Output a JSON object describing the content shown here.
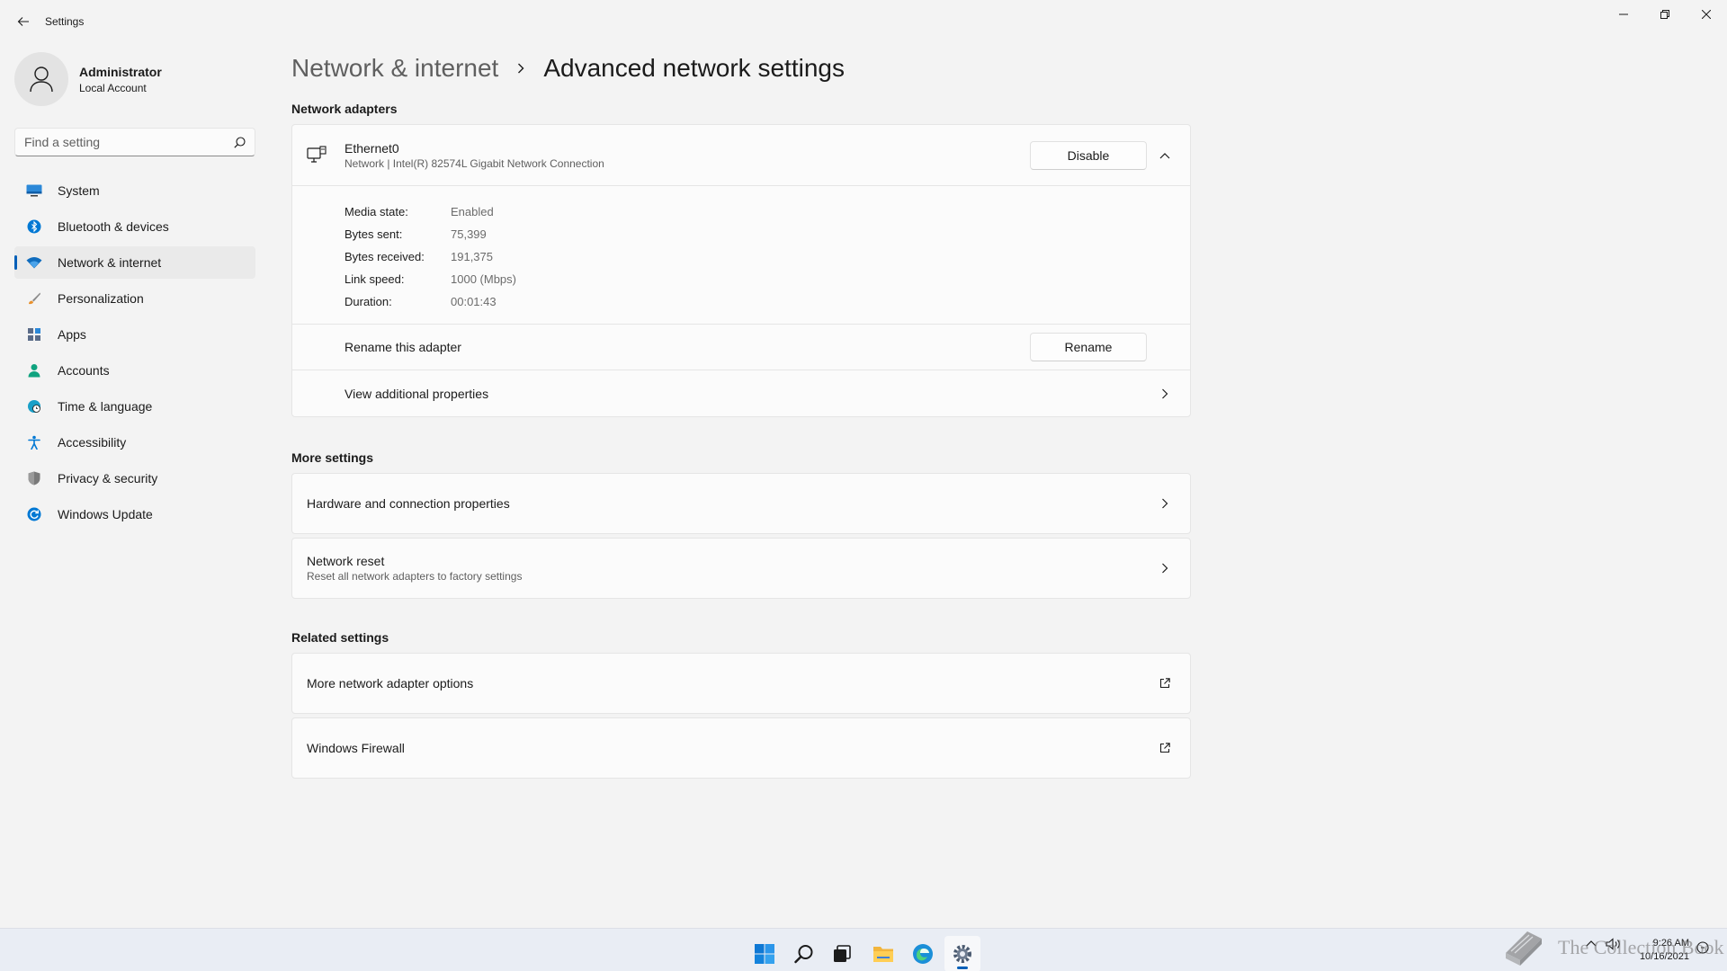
{
  "window": {
    "title": "Settings"
  },
  "profile": {
    "name": "Administrator",
    "account_type": "Local Account"
  },
  "search": {
    "placeholder": "Find a setting"
  },
  "sidebar": {
    "items": [
      {
        "label": "System",
        "icon": "system-icon",
        "color": "#0078d4"
      },
      {
        "label": "Bluetooth & devices",
        "icon": "bluetooth-icon",
        "color": "#0078d4"
      },
      {
        "label": "Network & internet",
        "icon": "wifi-icon",
        "color": "#0078d4",
        "active": true
      },
      {
        "label": "Personalization",
        "icon": "brush-icon",
        "color": "#e8912d"
      },
      {
        "label": "Apps",
        "icon": "apps-icon",
        "color": "#5a6b88"
      },
      {
        "label": "Accounts",
        "icon": "person-icon",
        "color": "#10a37f"
      },
      {
        "label": "Time & language",
        "icon": "globe-clock-icon",
        "color": "#1aa0c8"
      },
      {
        "label": "Accessibility",
        "icon": "accessibility-icon",
        "color": "#0078d4"
      },
      {
        "label": "Privacy & security",
        "icon": "shield-icon",
        "color": "#7a7a7a"
      },
      {
        "label": "Windows Update",
        "icon": "update-icon",
        "color": "#0078d4"
      }
    ]
  },
  "breadcrumb": {
    "parent": "Network & internet",
    "current": "Advanced network settings"
  },
  "network_adapters": {
    "title": "Network adapters",
    "adapter": {
      "name": "Ethernet0",
      "description": "Network | Intel(R) 82574L Gigabit Network Connection",
      "disable_label": "Disable",
      "properties": [
        {
          "key": "Media state:",
          "value": "Enabled"
        },
        {
          "key": "Bytes sent:",
          "value": "75,399"
        },
        {
          "key": "Bytes received:",
          "value": "191,375"
        },
        {
          "key": "Link speed:",
          "value": "1000 (Mbps)"
        },
        {
          "key": "Duration:",
          "value": "00:01:43"
        }
      ],
      "rename_text": "Rename this adapter",
      "rename_label": "Rename",
      "view_props_label": "View additional properties"
    }
  },
  "more_settings": {
    "title": "More settings",
    "items": [
      {
        "title": "Hardware and connection properties",
        "subtitle": ""
      },
      {
        "title": "Network reset",
        "subtitle": "Reset all network adapters to factory settings"
      }
    ]
  },
  "related_settings": {
    "title": "Related settings",
    "items": [
      {
        "title": "More network adapter options"
      },
      {
        "title": "Windows Firewall"
      }
    ]
  },
  "taskbar": {
    "icons": [
      "windows-start-icon",
      "search-icon",
      "task-view-icon",
      "file-explorer-icon",
      "edge-icon",
      "settings-icon"
    ],
    "time": "9:26 AM",
    "date": "10/16/2021"
  },
  "watermark": {
    "text": "The Collection Book"
  },
  "colors": {
    "accent": "#005fb8",
    "background": "#f3f3f3",
    "card": "#fbfbfb"
  }
}
